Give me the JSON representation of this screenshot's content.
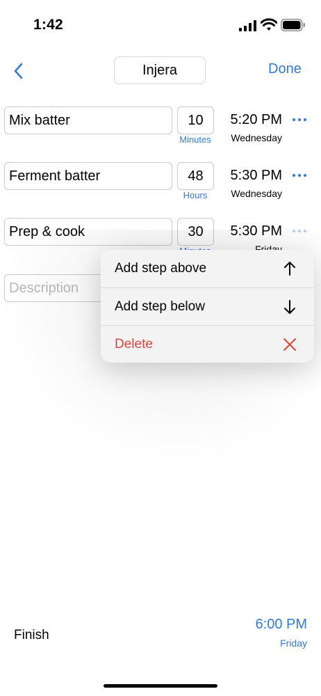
{
  "status": {
    "time": "1:42"
  },
  "nav": {
    "title": "Injera",
    "done_label": "Done"
  },
  "steps": [
    {
      "description": "Mix batter",
      "duration": "10",
      "unit": "Minutes",
      "time": "5:20 PM",
      "day": "Wednesday"
    },
    {
      "description": "Ferment batter",
      "duration": "48",
      "unit": "Hours",
      "time": "5:30 PM",
      "day": "Wednesday"
    },
    {
      "description": "Prep & cook",
      "duration": "30",
      "unit": "Minutes",
      "time": "5:30 PM",
      "day": "Friday"
    }
  ],
  "new_step": {
    "placeholder": "Description"
  },
  "menu": {
    "items": [
      {
        "label": "Add step above",
        "icon": "arrow-up-icon"
      },
      {
        "label": "Add step below",
        "icon": "arrow-down-icon"
      },
      {
        "label": "Delete",
        "icon": "x-icon",
        "color": "#e0443a"
      }
    ]
  },
  "finish": {
    "label": "Finish",
    "time": "6:00 PM",
    "day": "Friday"
  },
  "colors": {
    "accent": "#2f7ae5",
    "destructive": "#e0443a"
  }
}
